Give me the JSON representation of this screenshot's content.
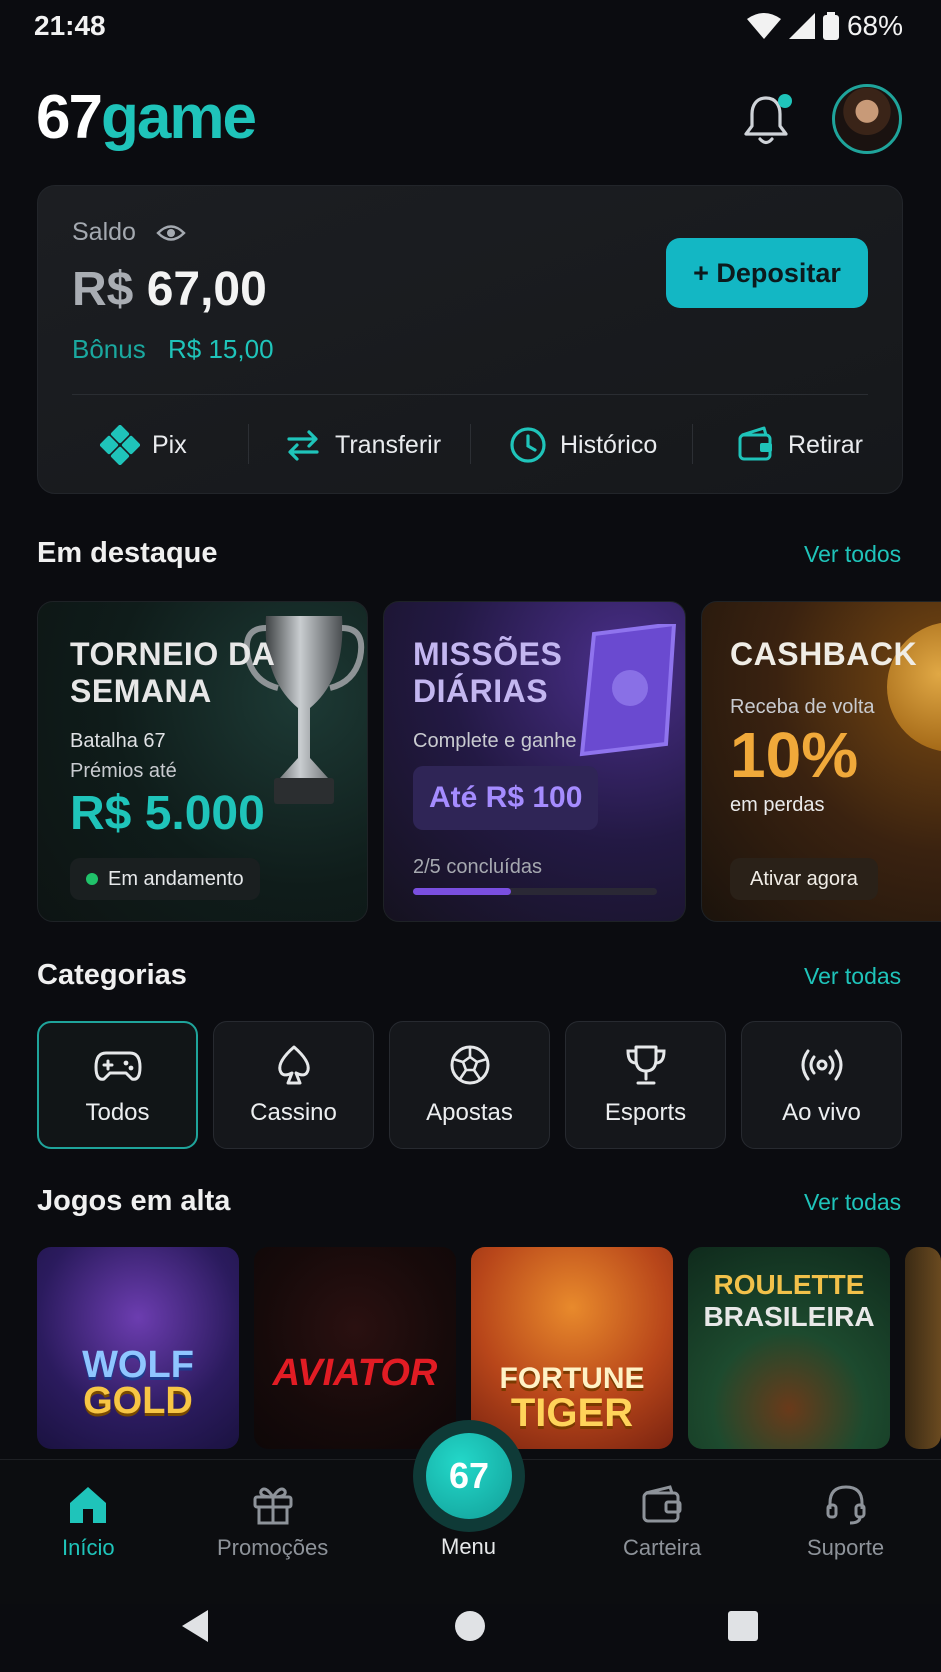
{
  "status": {
    "time": "21:48",
    "battery": "68%"
  },
  "header": {
    "logo_num": "67",
    "logo_word": "game"
  },
  "balance": {
    "label": "Saldo",
    "currency": "R$",
    "amount": "67,00",
    "bonus_label": "Bônus",
    "bonus_value": "R$ 15,00",
    "deposit_label": "+ Depositar",
    "actions": [
      "Pix",
      "Transferir",
      "Histórico",
      "Retirar"
    ]
  },
  "featured": {
    "title": "Em destaque",
    "link": "Ver todos",
    "cards": [
      {
        "title_1": "TORNEIO DA",
        "title_2": "SEMANA",
        "line_1": "Batalha 67",
        "line_2": "Prémios até",
        "highlight": "R$ 5.000",
        "pill": "Em andamento"
      },
      {
        "title_1": "MISSÕES",
        "title_2": "DIÁRIAS",
        "line_1": "Complete e ganhe",
        "highlight": "Até R$ 100",
        "progress_text": "2/5 concluídas",
        "progress": 0.4
      },
      {
        "title_1": "CASHBACK",
        "line_1": "Receba de volta",
        "highlight": "10%",
        "line_2": "em perdas",
        "pill": "Ativar agora"
      }
    ]
  },
  "categories": {
    "title": "Categorias",
    "link": "Ver todas",
    "items": [
      "Todos",
      "Cassino",
      "Apostas",
      "Esports",
      "Ao vivo"
    ]
  },
  "games": {
    "title": "Jogos em alta",
    "link": "Ver todas",
    "items": [
      {
        "line_1": "WOLF",
        "line_2": "GOLD"
      },
      {
        "line_1": "AVIATOR"
      },
      {
        "line_1": "FORTUNE",
        "line_2": "TIGER"
      },
      {
        "line_1": "ROULETTE",
        "line_2": "BRASILEIRA"
      }
    ]
  },
  "nav": {
    "items": [
      "Início",
      "Promoções",
      "Menu",
      "Carteira",
      "Suporte"
    ],
    "menu_badge": "67"
  },
  "colors": {
    "accent": "#1fc4ba",
    "deposit": "#13b7c4",
    "purple": "#7a4fe0",
    "gold": "#f0a93a"
  }
}
